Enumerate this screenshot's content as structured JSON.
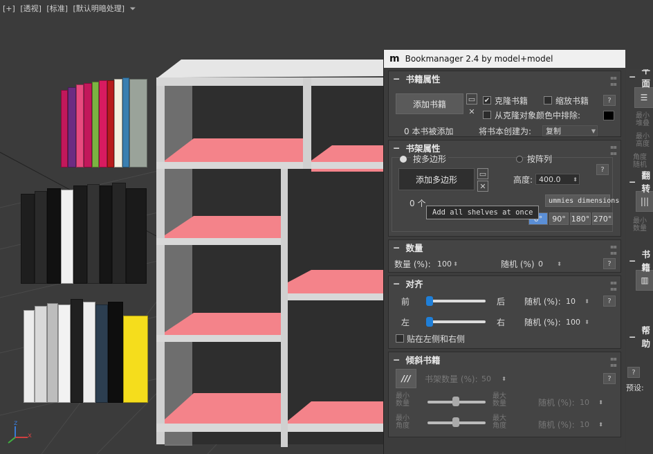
{
  "viewport": {
    "menu": [
      "[+]",
      "[透视]",
      "[标准]",
      "[默认明暗处理]"
    ],
    "axis_labels": {
      "z": "z",
      "x": "x"
    }
  },
  "panel": {
    "title": "Bookmanager 2.4 by model+model",
    "logo": "m",
    "book_props": {
      "header": "书籍属性",
      "add_books": "添加书籍",
      "clone_books": "克隆书籍",
      "scale_books": "缩放书籍",
      "exclude_color": "从克隆对象颜色中排除:",
      "count_text": "0 本书被添加",
      "create_as_label": "将书本创建为:",
      "create_as_value": "复制"
    },
    "shelf_props": {
      "header": "书架属性",
      "by_polygon": "按多边形",
      "by_array": "按阵列",
      "add_polygon": "添加多边形",
      "height_label": "高度:",
      "height_value": "400.0",
      "zero_text": "0 个",
      "dummies_text": "ummies dimensions",
      "angles": [
        "0°",
        "90°",
        "180°",
        "270°"
      ]
    },
    "quantity": {
      "header": "数量",
      "qty_label": "数量 (%):",
      "qty_value": "100",
      "rand_label": "随机 (%)",
      "rand_value": "0"
    },
    "align": {
      "header": "对齐",
      "front": "前",
      "back": "后",
      "left": "左",
      "right": "右",
      "rand1_label": "随机 (%):",
      "rand1_value": "10",
      "rand2_label": "随机 (%):",
      "rand2_value": "100",
      "stick_label": "贴在左侧和右侧",
      "front_back_level": 0.0,
      "left_right_level": 0.0
    },
    "tilt": {
      "header": "倾斜书籍",
      "shelf_qty_label": "书架数量 (%):",
      "shelf_qty_value": "50",
      "min_qty": "最小\n数量",
      "max_qty": "最大\n数量",
      "min_angle": "最小\n角度",
      "max_angle": "最大\n角度",
      "rand_a_label": "随机 (%):",
      "rand_a_value": "10",
      "rand_b_label": "随机 (%):",
      "rand_b_value": "10"
    },
    "tooltip": "Add all shelves at once",
    "help": "?"
  },
  "right_panel": {
    "labels": [
      "平面",
      "最小\n堆叠",
      "最小\n高度",
      "角度\n随机",
      "翻转",
      "最小\n数量",
      "书籍",
      "帮助",
      "预设:"
    ]
  },
  "colors": {
    "panel_bg": "#444444",
    "shelf": "#d4d4d4",
    "shelf_board": "#f4838a",
    "accent": "#1f7fd8",
    "arrow": "#e53935"
  }
}
